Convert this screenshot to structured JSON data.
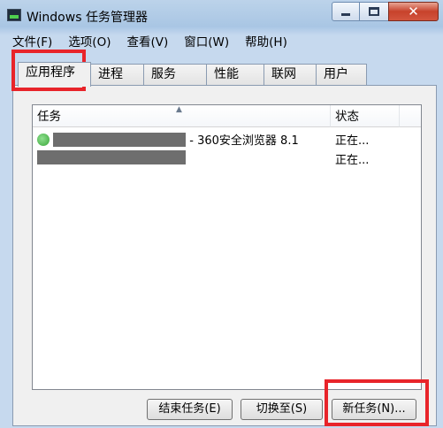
{
  "window": {
    "title": "Windows 任务管理器",
    "icon": "task-manager-icon",
    "controls": {
      "minimize": "minimize-icon",
      "maximize": "maximize-icon",
      "close": "✕"
    }
  },
  "menu": {
    "items": [
      "文件(F)",
      "选项(O)",
      "查看(V)",
      "窗口(W)",
      "帮助(H)"
    ]
  },
  "tabs": {
    "items": [
      "应用程序",
      "进程",
      "服务",
      "性能",
      "联网",
      "用户"
    ],
    "active": "应用程序"
  },
  "list": {
    "columns": {
      "task": "任务",
      "status": "状态"
    },
    "sort_indicator": "▲",
    "rows": [
      {
        "name_visible": "- 360安全浏览器 8.1",
        "status": "正在...",
        "name_redacted": true
      },
      {
        "name_visible": "",
        "status": "正在...",
        "name_redacted": true
      }
    ]
  },
  "buttons": {
    "end_task": "结束任务(E)",
    "switch_to": "切换至(S)",
    "new_task": "新任务(N)..."
  },
  "annotations": {
    "highlight_color": "#e8242a"
  }
}
